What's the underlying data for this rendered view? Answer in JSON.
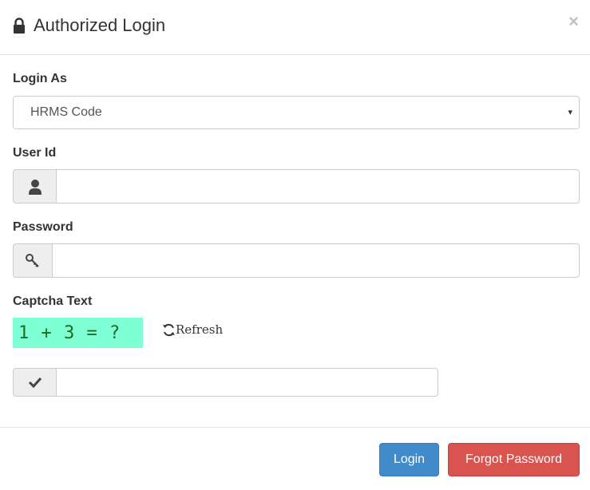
{
  "dialog": {
    "title": "Authorized Login",
    "close_symbol": "×"
  },
  "form": {
    "login_as": {
      "label": "Login As",
      "selected": "HRMS Code",
      "caret": "▾"
    },
    "user_id": {
      "label": "User Id",
      "value": "",
      "icon": "user-icon"
    },
    "password": {
      "label": "Password",
      "value": "",
      "icon": "key-icon"
    },
    "captcha": {
      "label": "Captcha Text",
      "challenge": "1 + 3 = ?",
      "refresh_label": "Refresh",
      "answer_value": "",
      "icon": "check-icon",
      "background_color": "#7fffd4"
    }
  },
  "footer": {
    "login_label": "Login",
    "forgot_label": "Forgot Password",
    "login_color": "#428bca",
    "forgot_color": "#d9534f"
  }
}
